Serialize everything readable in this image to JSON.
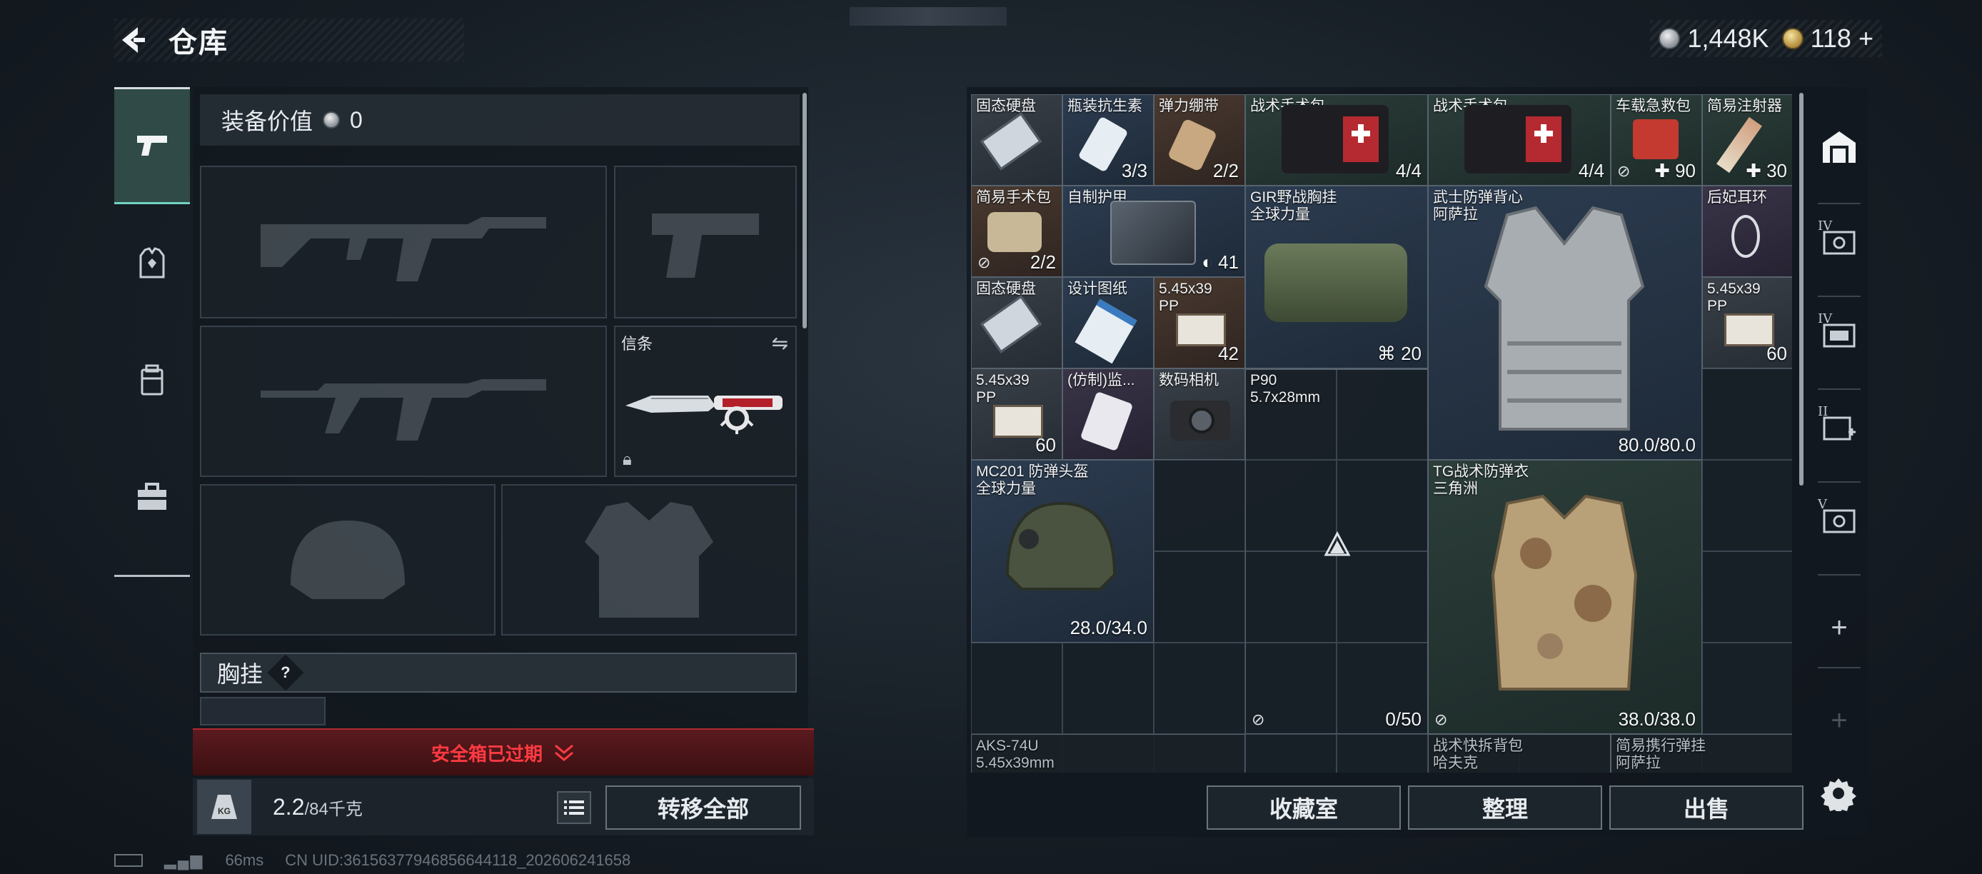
{
  "header": {
    "title": "仓库"
  },
  "currency": {
    "silver": "1,448K",
    "gold": "118",
    "add": "+"
  },
  "equipment": {
    "value_label": "装备价值",
    "value": "0",
    "knife_slot_label": "信条",
    "rig_label": "胸挂",
    "rig_help": "?"
  },
  "safe_box": {
    "text": "安全箱已过期"
  },
  "weight": {
    "current": "2.2",
    "max": "/84千克",
    "icon_text": "KG"
  },
  "buttons": {
    "transfer_all": "转移全部",
    "collection": "收藏室",
    "organize": "整理",
    "sell": "出售"
  },
  "status": {
    "ping": "66ms",
    "uid": "CN UID:36156377946856644118_202606241658"
  },
  "items": {
    "ssd1": {
      "name": "固态硬盘",
      "count": ""
    },
    "antibiotics": {
      "name": "瓶装抗生素",
      "count": "3/3"
    },
    "bandage": {
      "name": "弹力绷带",
      "count": "2/2"
    },
    "surgkit1": {
      "name": "战术手术包",
      "count": "4/4"
    },
    "surgkit2": {
      "name": "战术手术包",
      "count": "4/4"
    },
    "carkit": {
      "name": "车载急救包",
      "count": "90"
    },
    "injector": {
      "name": "简易注射器",
      "count": "30"
    },
    "simplekit": {
      "name": "简易手术包",
      "count": "2/2"
    },
    "armor_plate": {
      "name": "自制护甲",
      "count": "41"
    },
    "gir_rig": {
      "name": "GIR野战胸挂",
      "sub": "全球力量",
      "count": "20"
    },
    "samurai_vest": {
      "name": "武士防弹背心",
      "sub": "阿萨拉",
      "count": "80.0/80.0"
    },
    "earring": {
      "name": "后妃耳环",
      "count": ""
    },
    "ssd2": {
      "name": "固态硬盘",
      "count": ""
    },
    "blueprint": {
      "name": "设计图纸",
      "count": ""
    },
    "ammo545a": {
      "name": "5.45x39",
      "sub": "PP",
      "count": "42"
    },
    "ammo545b": {
      "name": "5.45x39",
      "sub": "PP",
      "count": "60"
    },
    "ammo545c": {
      "name": "5.45x39",
      "sub": "PP",
      "count": "60"
    },
    "monitor": {
      "name": "(仿制)监...",
      "count": ""
    },
    "camera": {
      "name": "数码相机",
      "count": ""
    },
    "p90": {
      "name": "P90",
      "sub": "5.7x28mm",
      "count": "0/50"
    },
    "helmet": {
      "name": "MC201 防弹头盔",
      "sub": "全球力量",
      "count": "28.0/34.0"
    },
    "tg_vest": {
      "name": "TG战术防弹衣",
      "sub": "三角洲",
      "count": "38.0/38.0"
    },
    "aks74u": {
      "name": "AKS-74U",
      "sub": "5.45x39mm",
      "count": ""
    },
    "backpack": {
      "name": "战术快拆背包",
      "sub": "哈夫克",
      "count": ""
    },
    "mag_rig": {
      "name": "简易携行弹挂",
      "sub": "阿萨拉",
      "count": ""
    }
  },
  "right_tabs": [
    "IV",
    "IV",
    "II",
    "V"
  ],
  "colors": {
    "accent": "#6fd3bf",
    "danger": "#ff3a42"
  }
}
